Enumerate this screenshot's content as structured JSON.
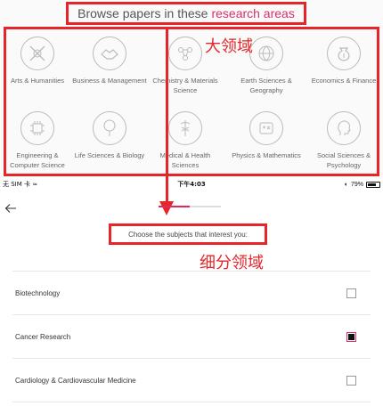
{
  "headline": {
    "prefix": "Browse papers in these",
    "accent": "research areas"
  },
  "annotations": {
    "major_areas": "大领域",
    "sub_areas": "细分领域"
  },
  "research_areas": [
    {
      "label_lines": [
        "Arts & Humanities"
      ],
      "icon": "palette-icon"
    },
    {
      "label_lines": [
        "Business & Management"
      ],
      "icon": "handshake-icon"
    },
    {
      "label_lines": [
        "Chemistry & Materials",
        "Science"
      ],
      "icon": "molecule-icon"
    },
    {
      "label_lines": [
        "Earth Sciences &",
        "Geography"
      ],
      "icon": "globe-icon"
    },
    {
      "label_lines": [
        "Economics & Finance"
      ],
      "icon": "money-bag-icon"
    },
    {
      "label_lines": [
        "Engineering &",
        "Computer Science"
      ],
      "icon": "chip-icon"
    },
    {
      "label_lines": [
        "Life Sciences & Biology"
      ],
      "icon": "tree-icon"
    },
    {
      "label_lines": [
        "Medical & Health",
        "Sciences"
      ],
      "icon": "caduceus-icon"
    },
    {
      "label_lines": [
        "Physics & Mathematics"
      ],
      "icon": "formula-icon"
    },
    {
      "label_lines": [
        "Social Sciences &",
        "Psychology"
      ],
      "icon": "head-profile-icon"
    }
  ],
  "status_bar": {
    "carrier": "无 SIM 卡",
    "time": "下午4:03",
    "battery_text": "79%",
    "battery_level": 0.79
  },
  "onboarding": {
    "progress": 0.5,
    "prompt": "Choose the subjects that interest you:"
  },
  "subjects": [
    {
      "label": "Biotechnology",
      "checked": false
    },
    {
      "label": "Cancer Research",
      "checked": true
    },
    {
      "label": "Cardiology & Cardiovascular Medicine",
      "checked": false
    }
  ],
  "colors": {
    "annotation_red": "#e5252a",
    "accent_pink": "#d8306a"
  }
}
